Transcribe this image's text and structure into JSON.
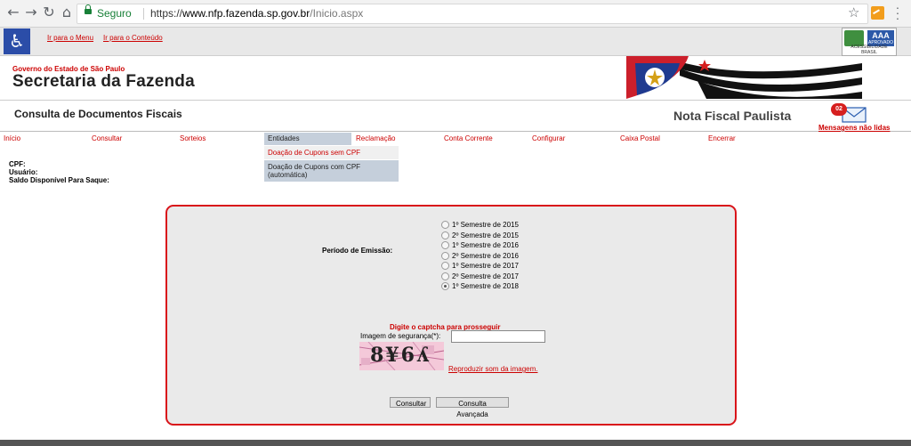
{
  "browser": {
    "secure_label": "Seguro",
    "url_scheme": "https://",
    "url_host": "www.nfp.fazenda.sp.gov.br",
    "url_path": "/Inicio.aspx"
  },
  "accessibility": {
    "skip_menu": "Ir para o Menu",
    "skip_content": "Ir para o Conteúdo",
    "badge_main": "AAA",
    "badge_sub": "APROVADO",
    "badge_foot": "ACESSIBILIDADE BRASIL"
  },
  "header": {
    "gov": "Governo do Estado de São Paulo",
    "secretaria": "Secretaria da Fazenda"
  },
  "title_bar": {
    "page_title": "Consulta de Documentos Fiscais",
    "brand": "Nota Fiscal Paulista",
    "unread_count": "02",
    "messages": "Mensagens não lidas"
  },
  "menu": {
    "items": [
      "Início",
      "Consultar",
      "Sorteios",
      "Entidades",
      "Reclamação",
      "Conta Corrente",
      "Configurar",
      "Caixa Postal",
      "Encerrar"
    ],
    "active": "Entidades",
    "submenu": [
      "Doação de Cupons sem CPF",
      "Doação de Cupons com CPF (automática)"
    ]
  },
  "user_info": {
    "cpf": "CPF:",
    "usuario": "Usuário:",
    "saldo": "Saldo Disponível Para Saque:"
  },
  "form": {
    "period_label": "Período de Emissão:",
    "periods": [
      "1º Semestre de 2015",
      "2º Semestre de 2015",
      "1º Semestre de 2016",
      "2º Semestre de 2016",
      "1º Semestre de 2017",
      "2º Semestre de 2017",
      "1º Semestre de 2018"
    ],
    "selected_period": "1º Semestre de 2018",
    "captcha_msg": "Digite o captcha para prosseguir",
    "security_label": "Imagem de segurança(*):",
    "security_value": "",
    "captcha_text": "8¥6ʎ",
    "audio_link": "Reproduzir som da imagem.",
    "btn_consultar": "Consultar",
    "btn_avancada": "Consulta Avançada"
  },
  "colors": {
    "accent_red": "#cc0000",
    "panel_border": "#d9141a",
    "menu_active": "#c5cfdb"
  }
}
